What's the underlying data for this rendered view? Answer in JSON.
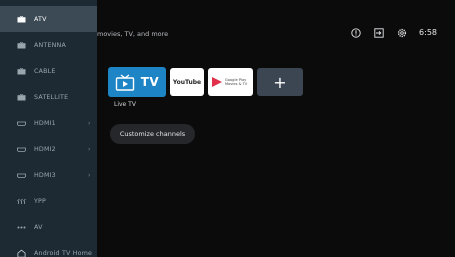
{
  "search_hint": "movies, TV, and more",
  "status": {
    "time": "6:58",
    "icons": [
      "info-icon",
      "input-icon",
      "settings-icon"
    ]
  },
  "apps": {
    "live_tv_tile": "TV",
    "youtube_tile": "YouTube",
    "play_movies_tile": [
      "Google Play",
      "Movies & TV"
    ],
    "add_tile": "+",
    "focused_label": "Live TV"
  },
  "customize_label": "Customize channels",
  "sidebar": {
    "items": [
      {
        "label": "ATV",
        "icon": "tv-icon",
        "selected": true,
        "chevron": false
      },
      {
        "label": "ANTENNA",
        "icon": "tv-icon",
        "selected": false,
        "chevron": false
      },
      {
        "label": "CABLE",
        "icon": "tv-icon",
        "selected": false,
        "chevron": false
      },
      {
        "label": "SATELLITE",
        "icon": "tv-icon",
        "selected": false,
        "chevron": false
      },
      {
        "label": "HDMI1",
        "icon": "hdmi-icon",
        "selected": false,
        "chevron": true
      },
      {
        "label": "HDMI2",
        "icon": "hdmi-icon",
        "selected": false,
        "chevron": true
      },
      {
        "label": "HDMI3",
        "icon": "hdmi-icon",
        "selected": false,
        "chevron": true
      },
      {
        "label": "YPP",
        "icon": "component-icon",
        "selected": false,
        "chevron": false
      },
      {
        "label": "AV",
        "icon": "composite-icon",
        "selected": false,
        "chevron": false
      },
      {
        "label": "Android TV Home",
        "icon": "home-icon",
        "selected": false,
        "chevron": false
      }
    ],
    "chevron": "›"
  },
  "colors": {
    "sidebar_bg": "#1d2a33",
    "sidebar_selected": "#3b4a55",
    "live_tv_blue": "#1d84c5",
    "add_tile": "#3b4652",
    "background": "#0b0b0c"
  }
}
